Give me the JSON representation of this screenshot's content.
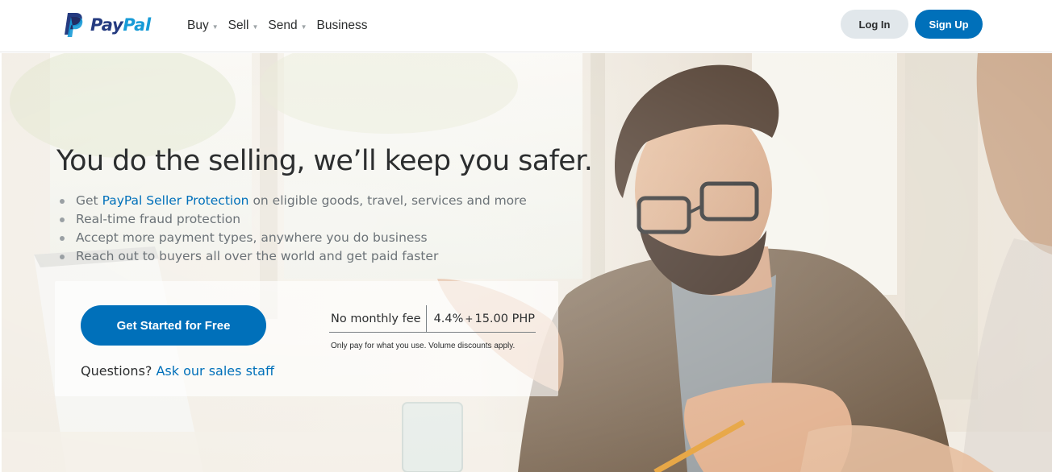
{
  "brand": {
    "name_part1": "Pay",
    "name_part2": "Pal",
    "colors": {
      "dark_blue": "#253b80",
      "light_blue": "#179bd7",
      "primary": "#0070ba"
    }
  },
  "nav": {
    "items": [
      {
        "label": "Buy",
        "has_dropdown": true
      },
      {
        "label": "Sell",
        "has_dropdown": true
      },
      {
        "label": "Send",
        "has_dropdown": true
      },
      {
        "label": "Business",
        "has_dropdown": false
      }
    ],
    "caret_icon": "chevron-down-icon"
  },
  "auth": {
    "login_label": "Log In",
    "signup_label": "Sign Up"
  },
  "hero": {
    "headline": "You do the selling, we’ll keep you safer.",
    "bullets": {
      "b1_prefix": "Get ",
      "b1_link": "PayPal Seller Protection",
      "b1_suffix": " on eligible goods, travel, services and more",
      "b2": "Real-time fraud protection",
      "b3": "Accept more payment types, anywhere you do business",
      "b4": "Reach out to buyers all over the world and get paid faster"
    },
    "cta_label": "Get Started for Free",
    "questions_prefix": "Questions? ",
    "questions_link": "Ask our sales staff",
    "pricing": {
      "fee_label": "No monthly fee",
      "rate_percent": "4.4%",
      "rate_plus": "+",
      "rate_fixed": "15.00 PHP",
      "note": "Only pay for what you use. Volume discounts apply."
    }
  }
}
